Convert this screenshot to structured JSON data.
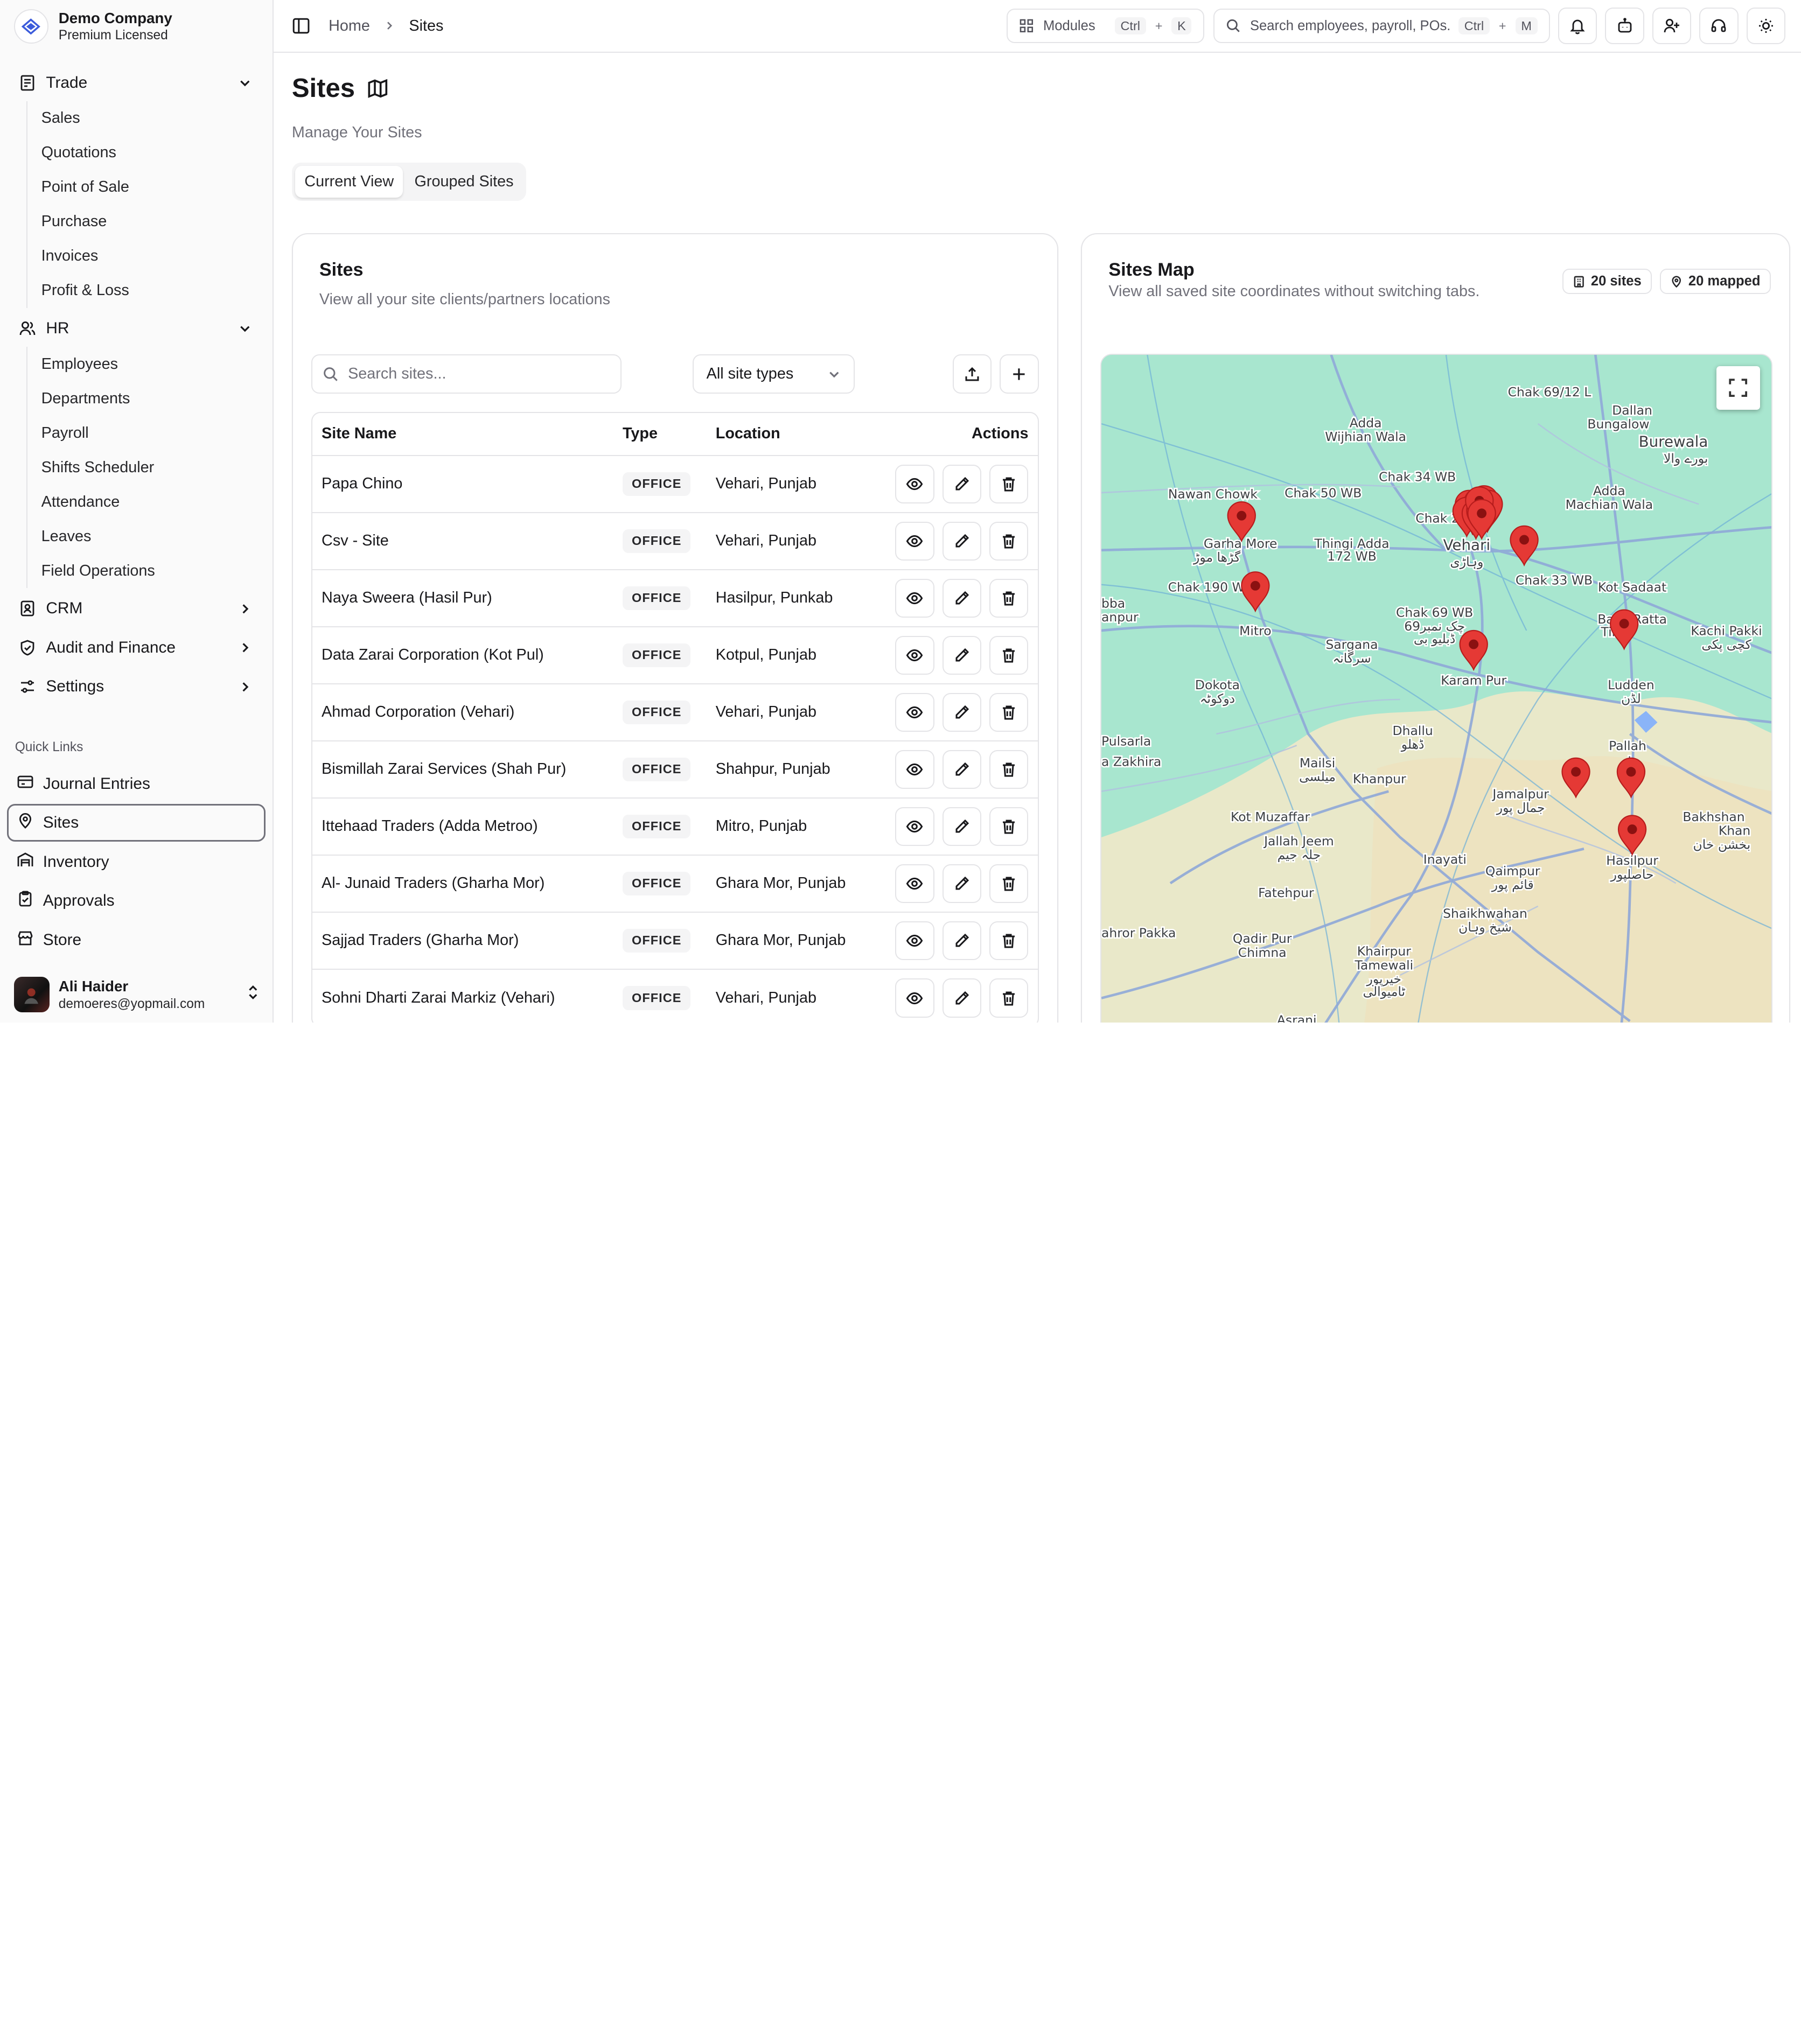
{
  "brand": {
    "name": "Demo Company",
    "subtitle": "Premium Licensed"
  },
  "sidebar": {
    "trade": {
      "label": "Trade",
      "items": [
        "Sales",
        "Quotations",
        "Point of Sale",
        "Purchase",
        "Invoices",
        "Profit & Loss"
      ]
    },
    "hr": {
      "label": "HR",
      "items": [
        "Employees",
        "Departments",
        "Payroll",
        "Shifts Scheduler",
        "Attendance",
        "Leaves",
        "Field Operations"
      ]
    },
    "crm": "CRM",
    "audit": "Audit and Finance",
    "settings": "Settings",
    "quick_links_title": "Quick Links",
    "quick_links": [
      "Journal Entries",
      "Sites",
      "Inventory",
      "Approvals",
      "Store"
    ]
  },
  "user": {
    "name": "Ali Haider",
    "email": "demoeres@yopmail.com"
  },
  "topbar": {
    "breadcrumb_home": "Home",
    "breadcrumb_current": "Sites",
    "modules_label": "Modules",
    "modules_key1": "Ctrl",
    "modules_plus": "+",
    "modules_key2": "K",
    "search_placeholder": "Search employees, payroll, POs...",
    "search_key1": "Ctrl",
    "search_plus": "+",
    "search_key2": "M"
  },
  "page": {
    "title": "Sites",
    "subtitle": "Manage Your Sites",
    "tabs": [
      "Current View",
      "Grouped Sites"
    ]
  },
  "sites_card": {
    "title": "Sites",
    "subtitle": "View all your site clients/partners locations",
    "search_placeholder": "Search sites...",
    "filter_value": "All site types",
    "columns": [
      "Site Name",
      "Type",
      "Location",
      "Actions"
    ],
    "rows": [
      {
        "name": "Papa Chino",
        "type": "OFFICE",
        "location": "Vehari, Punjab"
      },
      {
        "name": "Csv - Site",
        "type": "OFFICE",
        "location": "Vehari, Punjab"
      },
      {
        "name": "Naya Sweera (Hasil Pur)",
        "type": "OFFICE",
        "location": "Hasilpur, Punkab"
      },
      {
        "name": "Data Zarai Corporation (Kot Pul)",
        "type": "OFFICE",
        "location": "Kotpul, Punjab"
      },
      {
        "name": "Ahmad Corporation (Vehari)",
        "type": "OFFICE",
        "location": "Vehari, Punjab"
      },
      {
        "name": "Bismillah Zarai Services (Shah Pur)",
        "type": "OFFICE",
        "location": "Shahpur, Punjab"
      },
      {
        "name": "Ittehaad Traders (Adda Metroo)",
        "type": "OFFICE",
        "location": "Mitro, Punjab"
      },
      {
        "name": "Al- Junaid Traders (Gharha Mor)",
        "type": "OFFICE",
        "location": "Ghara Mor, Punjab"
      },
      {
        "name": "Sajjad Traders (Gharha Mor)",
        "type": "OFFICE",
        "location": "Ghara Mor, Punjab"
      },
      {
        "name": "Sohni Dharti Zarai Markiz (Vehari)",
        "type": "OFFICE",
        "location": "Vehari, Punjab"
      }
    ]
  },
  "map_card": {
    "title": "Sites Map",
    "subtitle": "View all saved site coordinates without switching tabs.",
    "sites_badge": "20 sites",
    "mapped_badge": "20 mapped",
    "place_labels": [
      "Chak 69/12 L",
      "Dallan",
      "Bungalow",
      "Burewala",
      "بورے والا",
      "Adda",
      "Wijhian Wala",
      "Chak 34 WB",
      "Nawan Chowk",
      "Chak 50 WB",
      "Adda",
      "Machian Wala",
      "Chak 24",
      "Garha More",
      "گڑھا موڑ",
      "Thingi Adda",
      "172 WB",
      "Vehari",
      "وہاڑی",
      "Chak 33 WB",
      "Kot Sadaat",
      "Chak 190 WB",
      "bba",
      "anpur",
      "Mitro",
      "Chak 69 WB",
      "چک نمبر69",
      "ڈبلیو بی",
      "Basti Ratta",
      "Tibbi",
      "Kachi Pakki",
      "کچی پکی",
      "Sargana",
      "سرگانہ",
      "Karam Pur",
      "Dokota",
      "دوکوٹہ",
      "Ludden",
      "لڈن",
      "Dhallu",
      "ڈھلو",
      "Pulsarla",
      "a Zakhira",
      "Mailsi",
      "میلسی",
      "Khanpur",
      "Pallah",
      "پلہ",
      "Jamalpur",
      "جمال پور",
      "Kot Muzaffar",
      "Jallah Jeem",
      "جلہ جیم",
      "Inayati",
      "Qaimpur",
      "قائم پور",
      "Hasilpur",
      "حاصلپور",
      "Bakhshan",
      "Khan",
      "بخشن خان",
      "Fatehpur",
      "Shaikhwahan",
      "شیخ وہان",
      "ahror Pakka",
      "Qadir Pur",
      "Chimna",
      "Khairpur",
      "Tamewali",
      "خیرپور",
      "ٹامیوالی",
      "Asrani"
    ]
  },
  "colors": {
    "accent": "#18181b",
    "border": "#e4e4e7",
    "muted_text": "#71717a",
    "map_land": "#a8e6cf",
    "map_road": "#8fa8d8",
    "marker": "#e53935"
  },
  "icons": {
    "sidebar_toggle": "sidebar-toggle-icon",
    "modules": "grid-icon",
    "search": "search-icon",
    "bell": "bell-icon",
    "bot": "bot-icon",
    "user_plus": "user-plus-icon",
    "headset": "headset-icon",
    "theme": "sun-icon",
    "title": "map-icon",
    "upload": "upload-icon",
    "add": "plus-icon",
    "view": "eye-icon",
    "edit": "pencil-icon",
    "delete": "trash-icon"
  }
}
